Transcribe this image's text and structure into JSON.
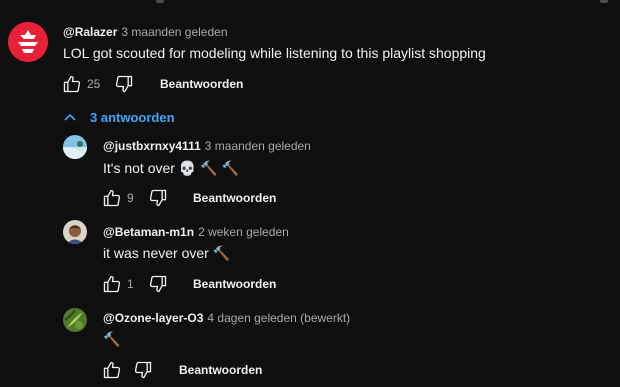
{
  "comment": {
    "author": "@Ralazer",
    "time": "3 maanden geleden",
    "text": "LOL got scouted for modeling while listening to this playlist shopping",
    "likes": "25",
    "reply_label": "Beantwoorden"
  },
  "replies_toggle": {
    "label": "3 antwoorden",
    "color": "#3ea6ff"
  },
  "replies": [
    {
      "author": "@justbxrnxy4111",
      "time": "3 maanden geleden",
      "text": "It's not over 💀 🔨 🔨",
      "likes": "9",
      "reply_label": "Beantwoorden"
    },
    {
      "author": "@Betaman-m1n",
      "time": "2 weken geleden",
      "text": "it was never over 🔨",
      "likes": "1",
      "reply_label": "Beantwoorden"
    },
    {
      "author": "@Ozone-layer-O3",
      "time": "4 dagen geleden (bewerkt)",
      "text": "🔨",
      "likes": "",
      "reply_label": "Beantwoorden"
    }
  ],
  "icons": {
    "like": "thumbs-up-icon",
    "dislike": "thumbs-down-icon",
    "collapse": "chevron-up-icon"
  },
  "colors": {
    "background": "#0f0f0f",
    "text": "#f1f1f1",
    "secondary_text": "#aaaaaa",
    "link": "#3ea6ff",
    "brand_avatar": "#e8203a"
  }
}
